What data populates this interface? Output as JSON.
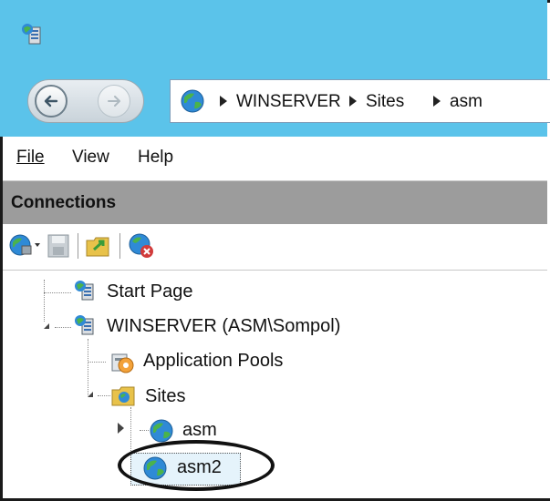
{
  "window": {
    "app_icon": "iis-server-icon"
  },
  "navigation": {
    "back_icon": "back-arrow-icon",
    "forward_icon": "forward-arrow-icon"
  },
  "address": {
    "icon": "globe-icon",
    "crumbs": [
      "WINSERVER",
      "Sites",
      "asm"
    ]
  },
  "menu": {
    "items": [
      "File",
      "View",
      "Help"
    ]
  },
  "connections": {
    "title": "Connections",
    "toolbar_icons": [
      "connect-globe-icon",
      "save-icon",
      "folder-up-icon",
      "disconnect-icon"
    ]
  },
  "tree": {
    "start_page": "Start Page",
    "server": "WINSERVER (ASM\\Sompol)",
    "app_pools": "Application Pools",
    "sites": "Sites",
    "site_asm": "asm",
    "site_asm2": "asm2"
  },
  "colors": {
    "titlebar": "#5bc3ea",
    "header": "#9c9c9c",
    "selection": "#e5f3fb"
  }
}
